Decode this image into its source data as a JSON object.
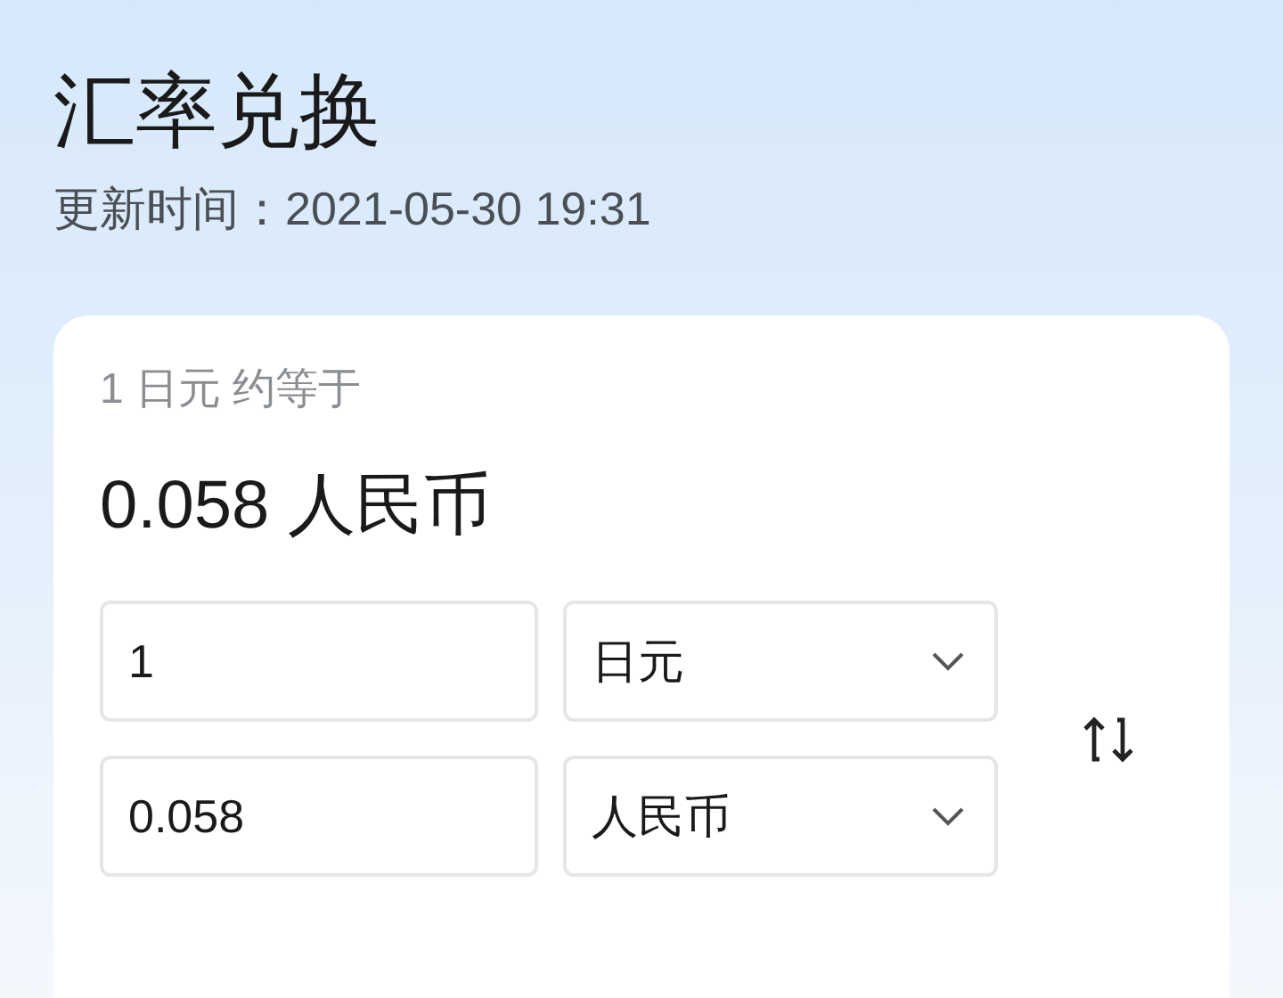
{
  "title": "汇率兑换",
  "update_time": "更新时间：2021-05-30 19:31",
  "card": {
    "summary": "1 日元 约等于",
    "result": "0.058 人民币",
    "rows": [
      {
        "amount": "1",
        "currency": "日元"
      },
      {
        "amount": "0.058",
        "currency": "人民币"
      }
    ]
  }
}
